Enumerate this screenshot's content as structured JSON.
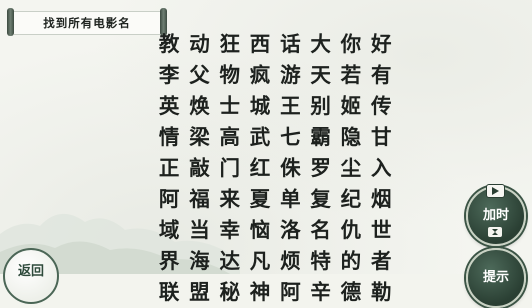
{
  "task": {
    "title": "找到所有电影名"
  },
  "grid": {
    "rows": [
      [
        "教",
        "动",
        "狂",
        "西",
        "话",
        "大",
        "你",
        "好",
        "李"
      ],
      [
        "父",
        "物",
        "疯",
        "游",
        "天",
        "若",
        "有",
        "英",
        "焕"
      ],
      [
        "士",
        "城",
        "王",
        "别",
        "姬",
        "传",
        "情",
        "梁",
        "高"
      ],
      [
        "武",
        "七",
        "霸",
        "隐",
        "甘",
        "正",
        "敲",
        "门",
        "红"
      ],
      [
        "侏",
        "罗",
        "尘",
        "入",
        "阿",
        "福",
        "来",
        "夏",
        "单"
      ],
      [
        "复",
        "纪",
        "烟",
        "域",
        "当",
        "幸",
        "恼",
        "洛",
        "名"
      ],
      [
        "仇",
        "世",
        "界",
        "海",
        "达",
        "凡",
        "烦",
        "特",
        "的"
      ],
      [
        "者",
        "联",
        "盟",
        "秘",
        "神",
        "阿",
        "辛",
        "德",
        "勒"
      ]
    ]
  },
  "buttons": {
    "add_time": {
      "label": "加时",
      "icon": "video-icon"
    },
    "hint": {
      "label": "提示"
    },
    "back": {
      "label": "返回"
    }
  }
}
